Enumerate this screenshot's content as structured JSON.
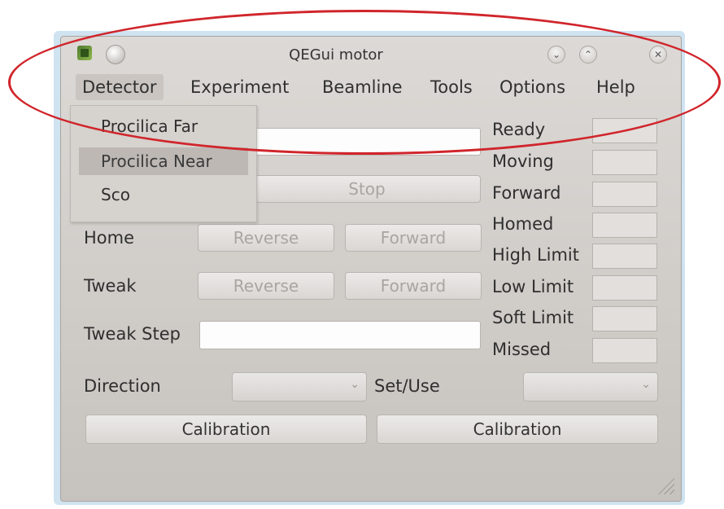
{
  "window": {
    "title": "QEGui motor",
    "controls": {
      "minimize_icon": "chevron-down-icon",
      "maximize_icon": "chevron-up-icon",
      "close_icon": "close-icon",
      "minimize_glyph": "⌄",
      "maximize_glyph": "⌃",
      "close_glyph": "✕"
    }
  },
  "menubar": {
    "items": [
      "Detector",
      "Experiment",
      "Beamline",
      "Tools",
      "Options",
      "Help"
    ],
    "active": "Detector"
  },
  "detector_menu": {
    "items": [
      "Procilica Far",
      "Procilica Near",
      "Sco"
    ],
    "highlighted": "Procilica Near"
  },
  "controls": {
    "stop_label": "Stop",
    "home_label": "Home",
    "home_reverse": "Reverse",
    "home_forward": "Forward",
    "tweak_label": "Tweak",
    "tweak_reverse": "Reverse",
    "tweak_forward": "Forward",
    "tweak_step_label": "Tweak Step",
    "direction_label": "Direction",
    "setuse_label": "Set/Use",
    "calibration_left": "Calibration",
    "calibration_right": "Calibration"
  },
  "status": {
    "labels": [
      "Ready",
      "Moving",
      "Forward",
      "Homed",
      "High Limit",
      "Low Limit",
      "Soft Limit",
      "Missed"
    ]
  },
  "annotation": {
    "color": "#d0252b"
  }
}
